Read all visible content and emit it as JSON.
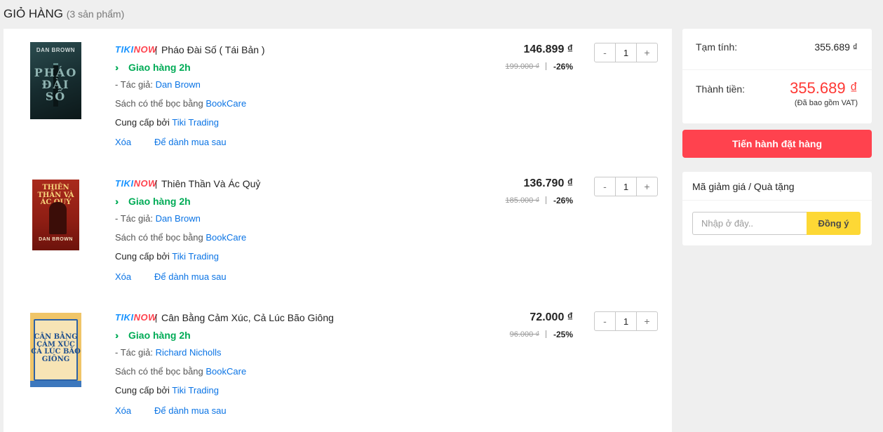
{
  "page": {
    "title": "GIỎ HÀNG",
    "count": "(3 sản phẩm)"
  },
  "cart": {
    "remove_label": "Xóa",
    "save_later_label": "Để dành mua sau",
    "items": [
      {
        "brand_tiki": "TIKI",
        "brand_now": "NOW",
        "name": "Pháo Đài Số ( Tái Bản )",
        "shipping": "Giao hàng 2h",
        "author_prefix": "- Tác giả: ",
        "author": "Dan Brown",
        "wrap_prefix": "Sách có thể bọc bằng ",
        "wrap_service": "BookCare",
        "seller_prefix": "Cung cấp bởi ",
        "seller": "Tiki Trading",
        "price": "146.899 ₫",
        "old_price": "199.000 ₫",
        "discount": "-26%",
        "qty_minus": "-",
        "quantity": "1",
        "qty_plus": "+",
        "cover": {
          "author": "DAN BROWN",
          "title": "PHÁO ĐÀI SỐ"
        }
      },
      {
        "brand_tiki": "TIKI",
        "brand_now": "NOW",
        "name": "Thiên Thần Và Ác Quỷ",
        "shipping": "Giao hàng 2h",
        "author_prefix": "- Tác giả: ",
        "author": "Dan Brown",
        "wrap_prefix": "Sách có thể bọc bằng ",
        "wrap_service": "BookCare",
        "seller_prefix": "Cung cấp bởi ",
        "seller": "Tiki Trading",
        "price": "136.790 ₫",
        "old_price": "185.000 ₫",
        "discount": "-26%",
        "qty_minus": "-",
        "quantity": "1",
        "qty_plus": "+",
        "cover": {
          "title": "THIÊN THẦN VÀ ÁC QUỶ",
          "author": "DAN BROWN"
        }
      },
      {
        "brand_tiki": "TIKI",
        "brand_now": "NOW",
        "name": "Cân Bằng Cảm Xúc, Cả Lúc Bão Giông",
        "shipping": "Giao hàng 2h",
        "author_prefix": "- Tác giả: ",
        "author": "Richard Nicholls",
        "wrap_prefix": "Sách có thể bọc bằng ",
        "wrap_service": "BookCare",
        "seller_prefix": "Cung cấp bởi ",
        "seller": "Tiki Trading",
        "price": "72.000 ₫",
        "old_price": "96.000 ₫",
        "discount": "-25%",
        "qty_minus": "-",
        "quantity": "1",
        "qty_plus": "+",
        "cover": {
          "title": "CÂN BẰNG CẢM XÚC CẢ LÚC BÃO GIÔNG"
        }
      }
    ]
  },
  "summary": {
    "subtotal_label": "Tạm tính:",
    "subtotal": "355.689 ₫",
    "total_label": "Thành tiền:",
    "total": "355.689 ₫",
    "vat_note": "(Đã bao gồm VAT)"
  },
  "checkout": {
    "label": "Tiến hành đặt hàng"
  },
  "coupon": {
    "title": "Mã giảm giá / Quà tặng",
    "placeholder": "Nhập ở đây..",
    "apply_label": "Đồng ý"
  },
  "colors": {
    "accent": "#1a94ff",
    "link": "#0b74e5",
    "cta": "#ff424e",
    "total": "#fe3834",
    "shipping": "#00ab56",
    "coupon_button": "#fdd835"
  },
  "icons": {
    "fast_shipping": "double-chevron-icon"
  }
}
